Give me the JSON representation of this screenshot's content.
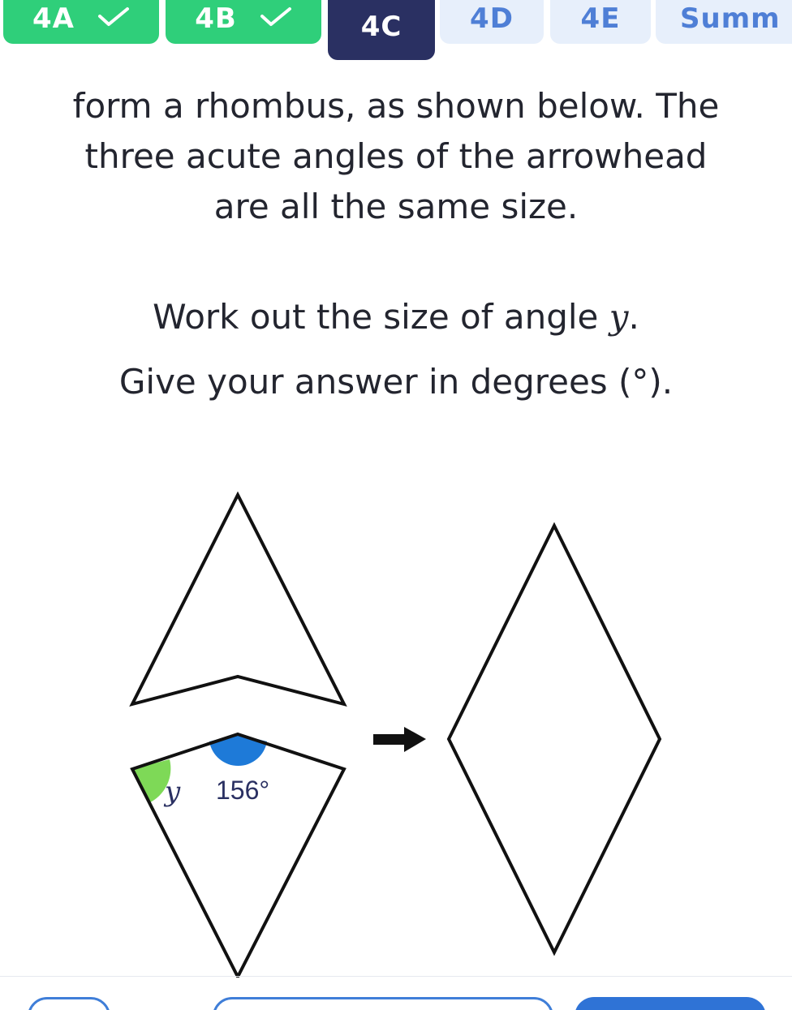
{
  "tabs": [
    {
      "label": "4A",
      "state": "done"
    },
    {
      "label": "4B",
      "state": "done"
    },
    {
      "label": "4C",
      "state": "active"
    },
    {
      "label": "4D",
      "state": "todo"
    },
    {
      "label": "4E",
      "state": "todo"
    },
    {
      "label": "Summ",
      "state": "todo"
    }
  ],
  "question": {
    "line1": "form a rhombus, as shown below. The",
    "line2": "three acute angles of the arrowhead",
    "line3": "are all the same size.",
    "prompt_prefix": "Work out the size of angle ",
    "prompt_var": "y",
    "prompt_suffix": ".",
    "instruction": "Give your answer in degrees (°)."
  },
  "diagram": {
    "angle_var_label": "y",
    "angle_value_label": "156°",
    "colors": {
      "outline": "#111111",
      "angle_y": "#7ed957",
      "angle_156": "#1e7ad8"
    }
  },
  "colors": {
    "tab_done": "#2fcf7a",
    "tab_active": "#2a3062",
    "tab_todo": "#e7effb",
    "button_primary": "#2f73d6"
  }
}
